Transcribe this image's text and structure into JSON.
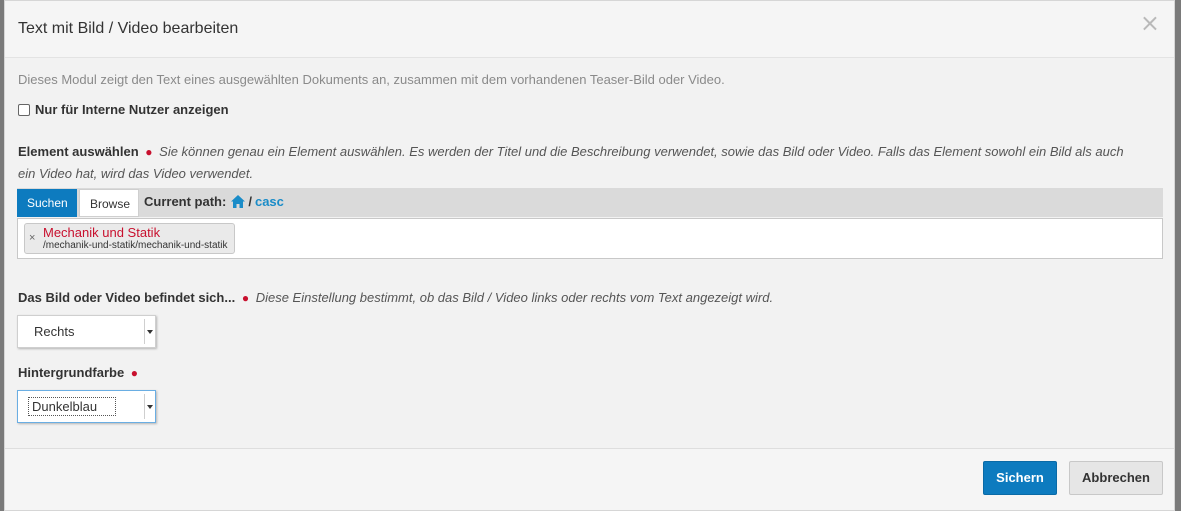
{
  "modal": {
    "title": "Text mit Bild / Video bearbeiten",
    "close_symbol": "×",
    "description": "Dieses Modul zeigt den Text eines ausgewählten Dokuments an, zusammen mit dem vorhandenen Teaser-Bild oder Video.",
    "internal_only": {
      "label": "Nur für Interne Nutzer anzeigen",
      "checked": false
    }
  },
  "element": {
    "label": "Element auswählen",
    "required_marker": "●",
    "hint_line1": "Sie können genau ein Element auswählen. Es werden der Titel und die Beschreibung verwendet, sowie das Bild oder Video. Falls das Element sowohl ein Bild als auch",
    "hint_line2": "ein Video hat, wird das Video verwendet.",
    "tabs": {
      "search": "Suchen",
      "browse": "Browse"
    },
    "current_path_label": "Current path:",
    "path_separator": "/",
    "path_segment": "casc",
    "selected": {
      "remove_symbol": "×",
      "title": "Mechanik und Statik",
      "path": "/mechanik-und-statik/mechanik-und-statik"
    }
  },
  "position": {
    "label": "Das Bild oder Video befindet sich...",
    "required_marker": "●",
    "hint": "Diese Einstellung bestimmt, ob das Bild / Video links oder rechts vom Text angezeigt wird.",
    "value": "Rechts"
  },
  "background": {
    "label": "Hintergrundfarbe",
    "required_marker": "●",
    "value": "Dunkelblau"
  },
  "footer": {
    "save": "Sichern",
    "cancel": "Abbrechen"
  },
  "colors": {
    "primary": "#0d7bbf",
    "required": "#c8102e",
    "link": "#1a8cc8"
  },
  "icons": {
    "home": "home-icon",
    "close": "close-icon",
    "remove": "remove-icon",
    "dropdown": "caret-down-icon"
  }
}
